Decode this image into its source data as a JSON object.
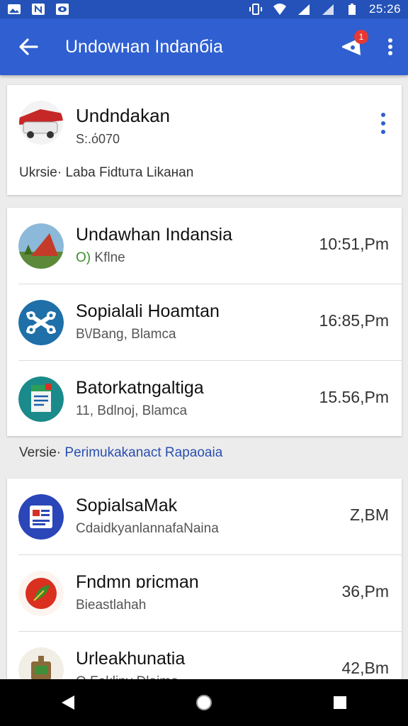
{
  "status_bar": {
    "time": "25:26",
    "left_icons": [
      "image-icon",
      "nfc-icon",
      "eye-icon"
    ],
    "right_icons": [
      "vibrate-icon",
      "wifi-icon",
      "signal-icon",
      "signal-icon",
      "battery-icon"
    ]
  },
  "app_bar": {
    "title": "Undowнan Indanбia",
    "notification_count": "1"
  },
  "profile": {
    "name": "Undndakan",
    "subtitle": "S:.ό070",
    "description": "Ukrsie· Laba Fidtuтa Likaнan"
  },
  "section_label": {
    "prefix": "Versie·",
    "accent": "Perimukakanact Rapaoaia"
  },
  "list1": [
    {
      "title": "Undawhan Indansia",
      "sub_prefix": "O)",
      "sub": "Kflne",
      "time": "10:51,Pm"
    },
    {
      "title": "Sopialali Hoamtan",
      "sub_prefix": "",
      "sub": "B\\/Bang, Blamca",
      "time": "16:85,Pm"
    },
    {
      "title": "Batorkatngaltiga",
      "sub_prefix": "",
      "sub": "11, Bdlnoj, Blamca",
      "time": "15.56,Pm"
    }
  ],
  "list2": [
    {
      "title": "SopialsaMak",
      "sub": "CdaidkyanlannafaNaina",
      "time": "Z,BM"
    },
    {
      "title": "Fndmn ɒricman",
      "sub": "Bieastlahah",
      "time": "36,Pm"
    },
    {
      "title": "Urleakhunatia",
      "sub": "O Fekliny Dlaimo",
      "time": "42,Bm"
    }
  ],
  "colors": {
    "app_bar": "#2f5fd0",
    "status_bar": "#2452b8",
    "accent_text": "#2a4fb0",
    "online": "#3a8f2a",
    "badge": "#e53935"
  }
}
